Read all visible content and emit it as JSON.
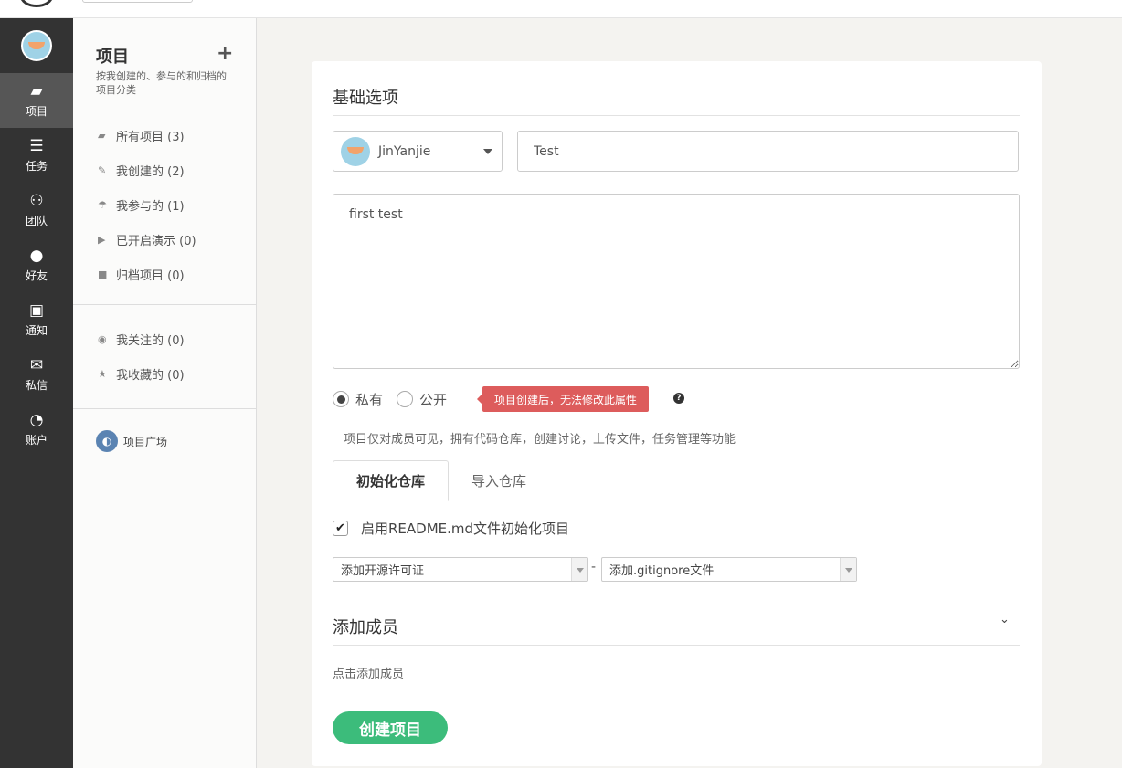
{
  "nav": {
    "items": [
      {
        "label": "项目",
        "icon": "folder-icon"
      },
      {
        "label": "任务",
        "icon": "tasks-icon"
      },
      {
        "label": "团队",
        "icon": "team-icon"
      },
      {
        "label": "好友",
        "icon": "user-icon"
      },
      {
        "label": "通知",
        "icon": "inbox-icon"
      },
      {
        "label": "私信",
        "icon": "mail-icon"
      },
      {
        "label": "账户",
        "icon": "dashboard-icon"
      }
    ]
  },
  "sidebar": {
    "title": "项目",
    "subtitle": "按我创建的、参与的和归档的项目分类",
    "items": [
      {
        "label": "所有项目 (3)"
      },
      {
        "label": "我创建的 (2)"
      },
      {
        "label": "我参与的 (1)"
      },
      {
        "label": "已开启演示 (0)"
      },
      {
        "label": "归档项目 (0)"
      }
    ],
    "items2": [
      {
        "label": "我关注的 (0)"
      },
      {
        "label": "我收藏的 (0)"
      }
    ],
    "plaza": "项目广场"
  },
  "form": {
    "section_basic": "基础选项",
    "owner": "JinYanjie",
    "project_name": "Test",
    "description": "first test",
    "radio_private": "私有",
    "radio_public": "公开",
    "warning": "项目创建后，无法修改此属性",
    "help": "?",
    "visibility_desc": "项目仅对成员可见，拥有代码仓库，创建讨论，上传文件，任务管理等功能",
    "tab_init": "初始化仓库",
    "tab_import": "导入仓库",
    "readme_label": "启用README.md文件初始化项目",
    "license_select": "添加开源许可证",
    "dash": "-",
    "gitignore_select": "添加.gitignore文件",
    "section_members": "添加成员",
    "add_member_link": "点击添加成员",
    "create_button": "创建项目"
  },
  "colors": {
    "nav_bg": "#333333",
    "primary_green": "#3cbc7b",
    "warning_red": "#dd5c5c"
  }
}
